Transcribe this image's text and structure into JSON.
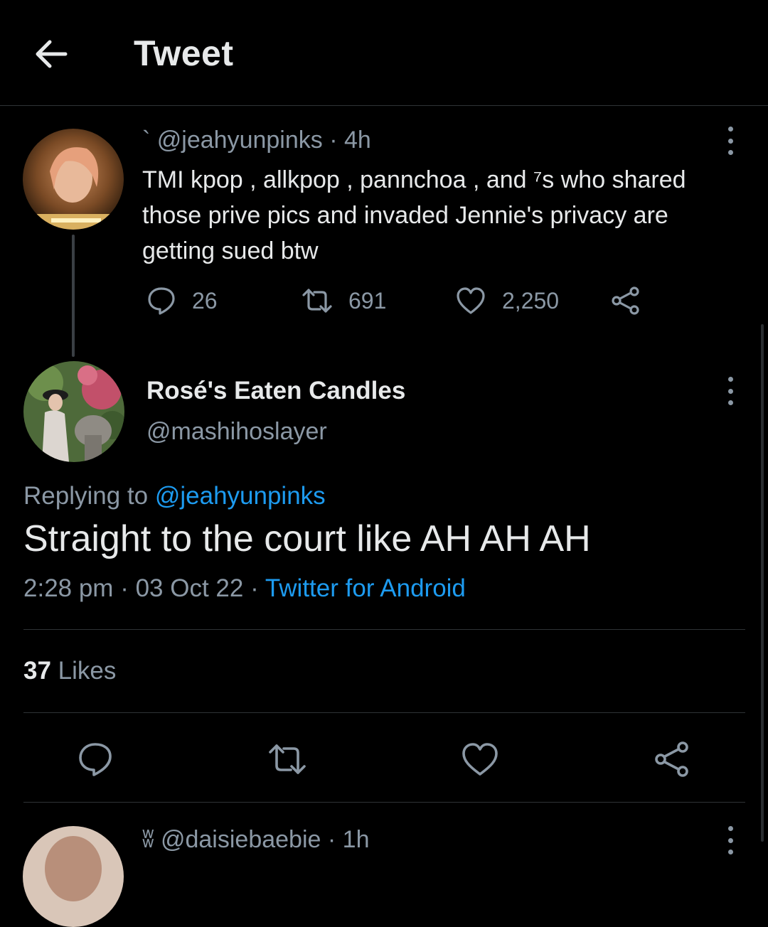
{
  "header": {
    "title": "Tweet",
    "back_icon": "arrow-left-icon"
  },
  "parent_tweet": {
    "display_name": "`",
    "handle": "@jeahyunpinks",
    "separator": "·",
    "time": "4h",
    "text": "TMI kpop , allkpop , pannchoa , and ⁷s who shared those prive pics and invaded Jennie's privacy are getting sued btw",
    "replies": "26",
    "retweets": "691",
    "likes": "2,250"
  },
  "main_tweet": {
    "display_name": "Rosé's Eaten Candles",
    "handle": "@mashihoslayer",
    "replying_prefix": "Replying to ",
    "replying_handle": "@jeahyunpinks",
    "text": "Straight to the court like AH AH AH",
    "time": "2:28 pm",
    "sep1": " · ",
    "date": "03 Oct 22",
    "sep2": " · ",
    "source": "Twitter for Android",
    "likes_count": "37",
    "likes_label": " Likes"
  },
  "next_tweet": {
    "display_name": "ʬ",
    "handle": "@daisiebaebie",
    "separator": "·",
    "time": "1h"
  },
  "colors": {
    "background": "#000000",
    "text": "#e7e9ea",
    "muted": "#8b98a5",
    "link": "#1d9bf0",
    "divider": "#2f3336"
  }
}
